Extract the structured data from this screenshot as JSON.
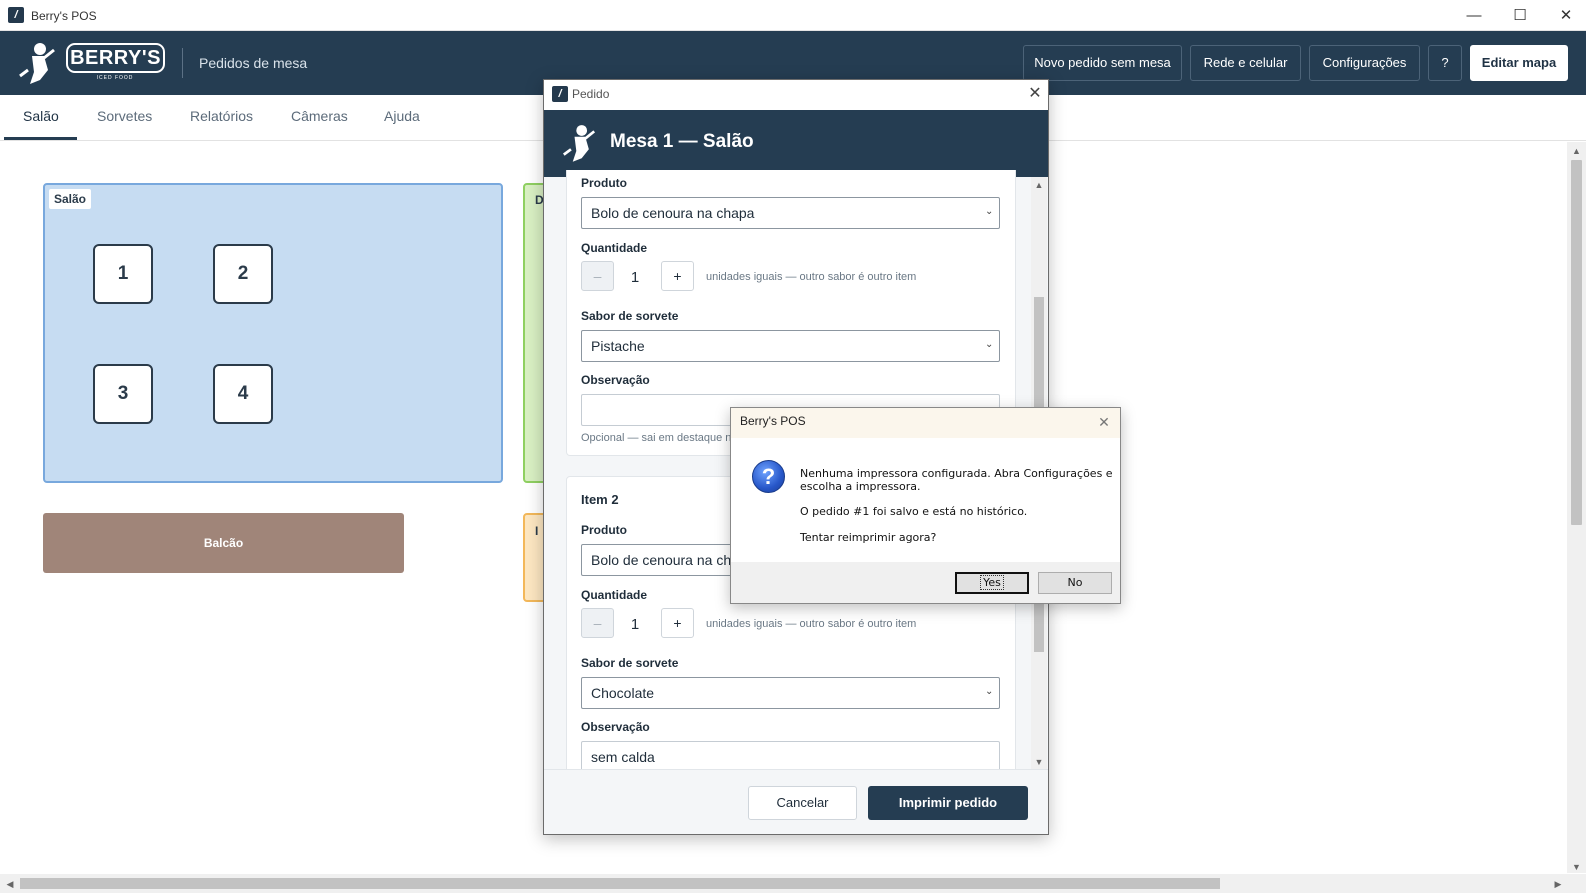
{
  "window": {
    "title": "Berry's POS",
    "icon": "berrys-app-icon",
    "minimize": "—",
    "maximize": "☐",
    "close": "✕"
  },
  "header": {
    "logo_text": "BERRY'S",
    "logo_subtext": "ICED FOOD",
    "page_title": "Pedidos de mesa",
    "buttons": {
      "new_order": "Novo pedido sem mesa",
      "network": "Rede e celular",
      "settings": "Configurações",
      "help": "?",
      "edit_map": "Editar mapa"
    }
  },
  "tabs": [
    "Salão",
    "Sorvetes",
    "Relatórios",
    "Câmeras",
    "Ajuda"
  ],
  "active_tab": "Salão",
  "floor": {
    "zone_salao": "Salão",
    "tables": [
      "1",
      "2",
      "3",
      "4"
    ],
    "zone_green_letter": "D",
    "zone_orange_letter": "I",
    "balcao": "Balcão",
    "colors": {
      "salao": "#c6dcf2",
      "green": "#d9f0c3",
      "orange": "#fde7c2",
      "balcao": "#a08579"
    }
  },
  "order_dialog": {
    "window_title": "Pedido",
    "close": "✕",
    "heading": "Mesa 1 — Salão",
    "item1": {
      "product_label": "Produto",
      "product_value": "Bolo de cenoura na chapa",
      "quantity_label": "Quantidade",
      "minus": "–",
      "quantity": "1",
      "plus": "+",
      "quantity_hint": "unidades iguais — outro sabor é outro item",
      "flavor_label": "Sabor de sorvete",
      "flavor_value": "Pistache",
      "note_label": "Observação",
      "note_value": "",
      "note_hint": "Opcional — sai em destaque na"
    },
    "item2": {
      "title": "Item 2",
      "product_label": "Produto",
      "product_value": "Bolo de cenoura na cha",
      "quantity_label": "Quantidade",
      "minus": "–",
      "quantity": "1",
      "plus": "+",
      "quantity_hint": "unidades iguais — outro sabor é outro item",
      "flavor_label": "Sabor de sorvete",
      "flavor_value": "Chocolate",
      "note_label": "Observação",
      "note_value": "sem calda"
    },
    "cancel": "Cancelar",
    "print": "Imprimir pedido"
  },
  "message_box": {
    "title": "Berry's POS",
    "close": "✕",
    "icon": "question-icon",
    "line1a": "Nenhuma impressora configurada. Abra Configurações e",
    "line1b": "escolha a impressora.",
    "line2": "O pedido #1 foi salvo e está no histórico.",
    "line3": "Tentar reimprimir agora?",
    "yes": "Yes",
    "no": "No"
  }
}
